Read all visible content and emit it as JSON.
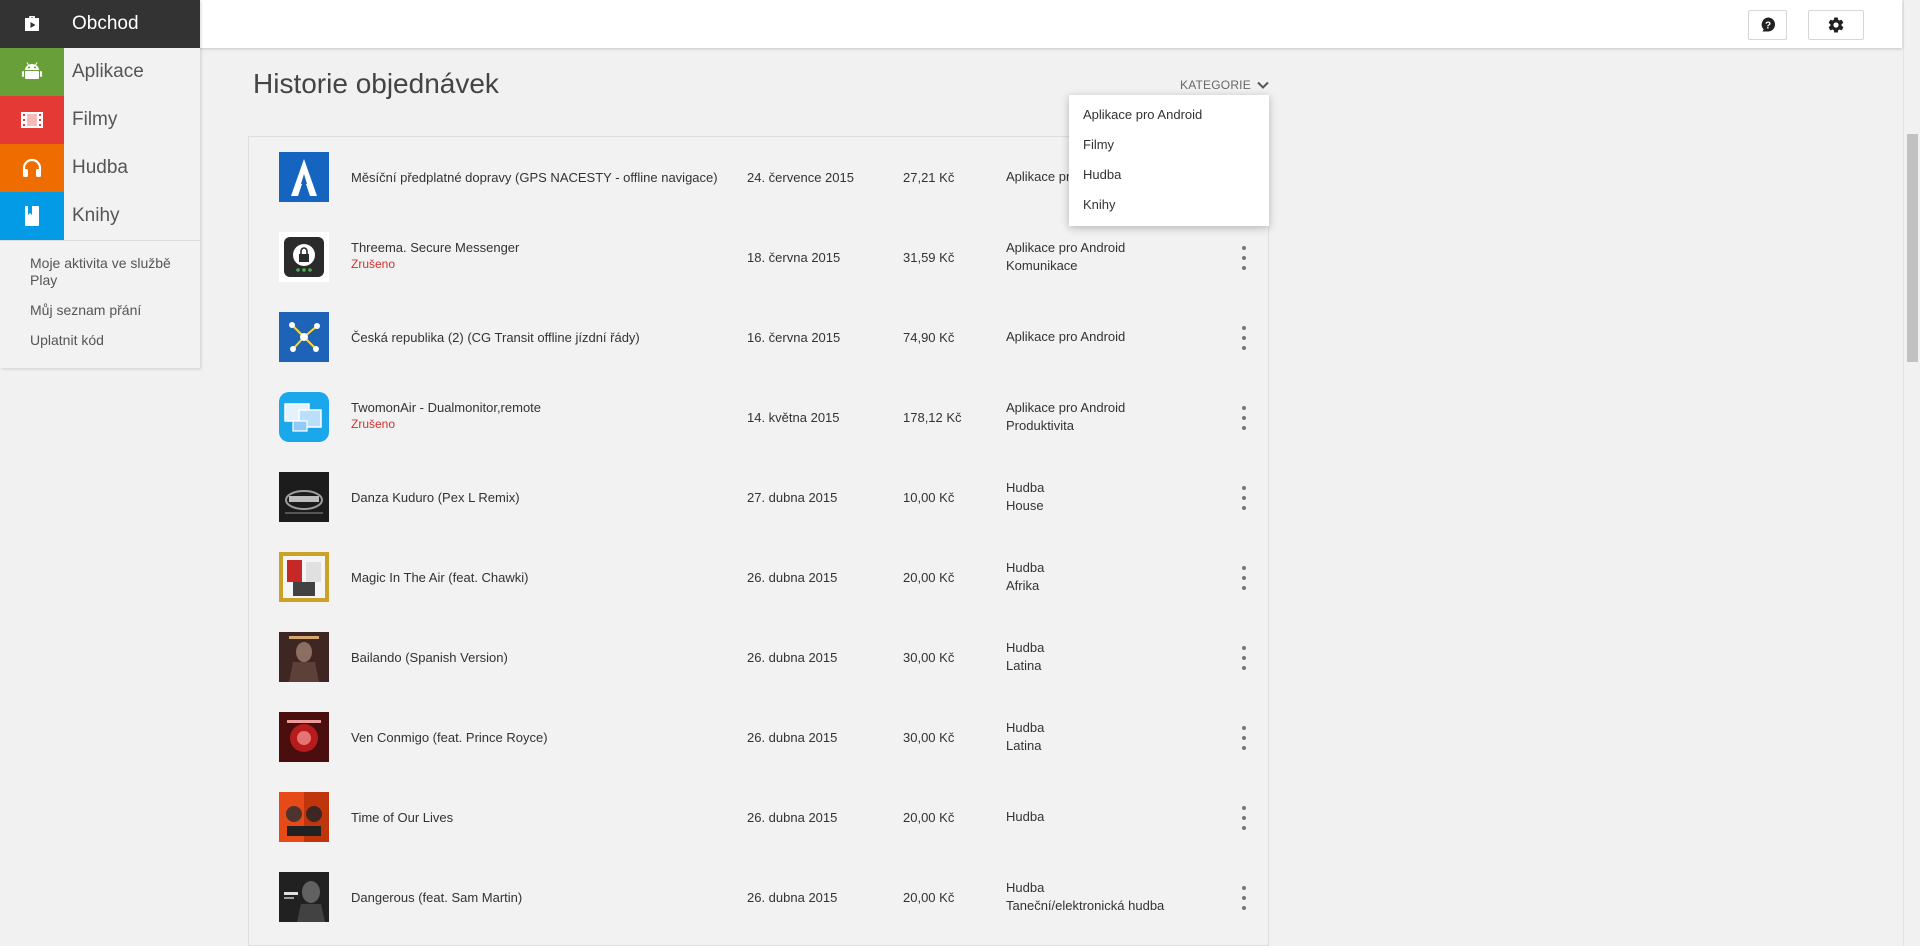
{
  "nav": {
    "store_label": "Obchod",
    "items": [
      {
        "label": "Aplikace",
        "icon": "android-icon",
        "color": "#689f38"
      },
      {
        "label": "Filmy",
        "icon": "film-icon",
        "color": "#e53935"
      },
      {
        "label": "Hudba",
        "icon": "headphones-icon",
        "color": "#ef6c00"
      },
      {
        "label": "Knihy",
        "icon": "book-icon",
        "color": "#039be5"
      }
    ],
    "links": [
      "Moje aktivita ve službě Play",
      "Můj seznam přání",
      "Uplatnit kód"
    ]
  },
  "page": {
    "title": "Historie objednávek",
    "category_button": "KATEGORIE"
  },
  "dropdown": {
    "options": [
      "Aplikace pro Android",
      "Filmy",
      "Hudba",
      "Knihy"
    ]
  },
  "orders": [
    {
      "name": "Měsíční předplatné dopravy (GPS NACESTY - offline navigace)",
      "status": "",
      "date": "24. července 2015",
      "price": "27,21 Kč",
      "category": "Aplikace pro Android",
      "subcategory": ""
    },
    {
      "name": "Threema. Secure Messenger",
      "status": "Zrušeno",
      "date": "18. června 2015",
      "price": "31,59 Kč",
      "category": "Aplikace pro Android",
      "subcategory": "Komunikace"
    },
    {
      "name": "Česká republika (2) (CG Transit offline jízdní řády)",
      "status": "",
      "date": "16. června 2015",
      "price": "74,90 Kč",
      "category": "Aplikace pro Android",
      "subcategory": ""
    },
    {
      "name": "TwomonAir - Dualmonitor,remote",
      "status": "Zrušeno",
      "date": "14. května 2015",
      "price": "178,12 Kč",
      "category": "Aplikace pro Android",
      "subcategory": "Produktivita"
    },
    {
      "name": "Danza Kuduro (Pex L Remix)",
      "status": "",
      "date": "27. dubna 2015",
      "price": "10,00 Kč",
      "category": "Hudba",
      "subcategory": "House"
    },
    {
      "name": "Magic In The Air (feat. Chawki)",
      "status": "",
      "date": "26. dubna 2015",
      "price": "20,00 Kč",
      "category": "Hudba",
      "subcategory": "Afrika"
    },
    {
      "name": "Bailando (Spanish Version)",
      "status": "",
      "date": "26. dubna 2015",
      "price": "30,00 Kč",
      "category": "Hudba",
      "subcategory": "Latina"
    },
    {
      "name": "Ven Conmigo (feat. Prince Royce)",
      "status": "",
      "date": "26. dubna 2015",
      "price": "30,00 Kč",
      "category": "Hudba",
      "subcategory": "Latina"
    },
    {
      "name": "Time of Our Lives",
      "status": "",
      "date": "26. dubna 2015",
      "price": "20,00 Kč",
      "category": "Hudba",
      "subcategory": ""
    },
    {
      "name": "Dangerous (feat. Sam Martin)",
      "status": "",
      "date": "26. dubna 2015",
      "price": "20,00 Kč",
      "category": "Hudba",
      "subcategory": "Taneční/elektronická hudba"
    }
  ]
}
